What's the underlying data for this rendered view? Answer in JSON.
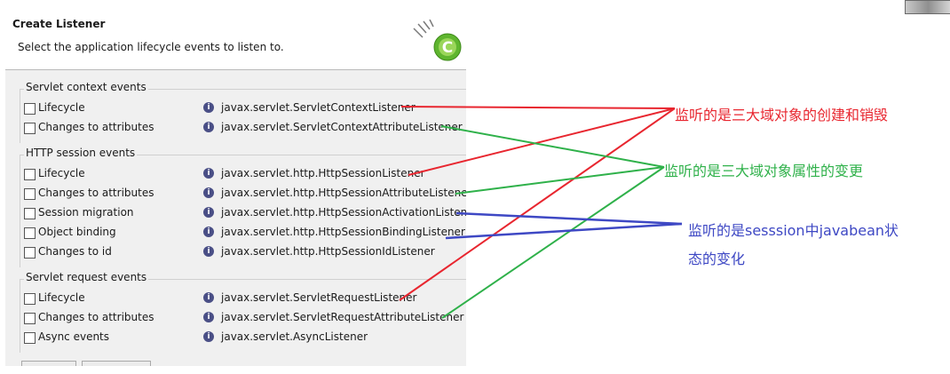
{
  "dialog": {
    "title": "Create Listener",
    "description": "Select the application lifecycle events to listen to."
  },
  "groups": [
    {
      "title": "Servlet context events",
      "items": [
        {
          "label": "Lifecycle",
          "class_name": "javax.servlet.ServletContextListener",
          "checked": false
        },
        {
          "label": "Changes to attributes",
          "class_name": "javax.servlet.ServletContextAttributeListener",
          "checked": false
        }
      ]
    },
    {
      "title": "HTTP session events",
      "items": [
        {
          "label": "Lifecycle",
          "class_name": "javax.servlet.http.HttpSessionListener",
          "checked": false
        },
        {
          "label": "Changes to attributes",
          "class_name": "javax.servlet.http.HttpSessionAttributeListener",
          "checked": false
        },
        {
          "label": "Session migration",
          "class_name": "javax.servlet.http.HttpSessionActivationListener",
          "checked": false
        },
        {
          "label": "Object binding",
          "class_name": "javax.servlet.http.HttpSessionBindingListener",
          "checked": false
        },
        {
          "label": "Changes to id",
          "class_name": "javax.servlet.http.HttpSessionIdListener",
          "checked": false
        }
      ]
    },
    {
      "title": "Servlet request events",
      "items": [
        {
          "label": "Lifecycle",
          "class_name": "javax.servlet.ServletRequestListener",
          "checked": false
        },
        {
          "label": "Changes to attributes",
          "class_name": "javax.servlet.ServletRequestAttributeListener",
          "checked": false
        },
        {
          "label": "Async events",
          "class_name": "javax.servlet.AsyncListener",
          "checked": false
        }
      ]
    }
  ],
  "annotations": {
    "lifecycle": {
      "text": "监听的是三大域对象的创建和销毁",
      "color": "#e8262f"
    },
    "attributes": {
      "text": "监听的是三大域对象属性的变更",
      "color": "#2fb14a"
    },
    "session_bean_line1": {
      "text": "监听的是sesssion中javabean状",
      "color": "#3e48c4"
    },
    "session_bean_line2": {
      "text": "态的变化",
      "color": "#3e48c4"
    }
  },
  "icons": {
    "info": "info-icon",
    "logo": "wizard-logo-icon"
  }
}
